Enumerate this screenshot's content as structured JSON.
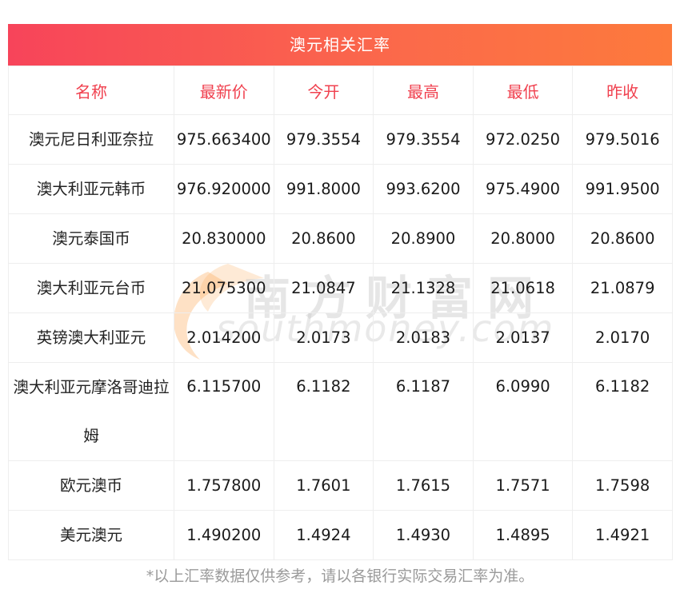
{
  "title": "澳元相关汇率",
  "headers": [
    "名称",
    "最新价",
    "今开",
    "最高",
    "最低",
    "昨收"
  ],
  "rows": [
    {
      "name": "澳元尼日利亚奈拉",
      "values": [
        "975.663400",
        "979.3554",
        "979.3554",
        "972.0250",
        "979.5016"
      ]
    },
    {
      "name": "澳大利亚元韩币",
      "values": [
        "976.920000",
        "991.8000",
        "993.6200",
        "975.4900",
        "991.9500"
      ]
    },
    {
      "name": "澳元泰国币",
      "values": [
        "20.830000",
        "20.8600",
        "20.8900",
        "20.8000",
        "20.8600"
      ]
    },
    {
      "name": "澳大利亚元台币",
      "values": [
        "21.075300",
        "21.0847",
        "21.1328",
        "21.0618",
        "21.0879"
      ]
    },
    {
      "name": "英镑澳大利亚元",
      "values": [
        "2.014200",
        "2.0173",
        "2.0183",
        "2.0137",
        "2.0170"
      ]
    },
    {
      "name": "澳大利亚元摩洛哥迪拉姆",
      "values": [
        "6.115700",
        "6.1182",
        "6.1187",
        "6.0990",
        "6.1182"
      ]
    },
    {
      "name": "欧元澳币",
      "values": [
        "1.757800",
        "1.7601",
        "1.7615",
        "1.7571",
        "1.7598"
      ]
    },
    {
      "name": "美元澳元",
      "values": [
        "1.490200",
        "1.4924",
        "1.4930",
        "1.4895",
        "1.4921"
      ]
    }
  ],
  "note": "*以上汇率数据仅供参考，请以各银行实际交易汇率为准。",
  "watermark": {
    "cn": "南方财富网",
    "en": "southmoney.com"
  },
  "colors": {
    "accent_start": "#f7445a",
    "accent_end": "#fd7a3c",
    "header_text": "#f0414f"
  }
}
